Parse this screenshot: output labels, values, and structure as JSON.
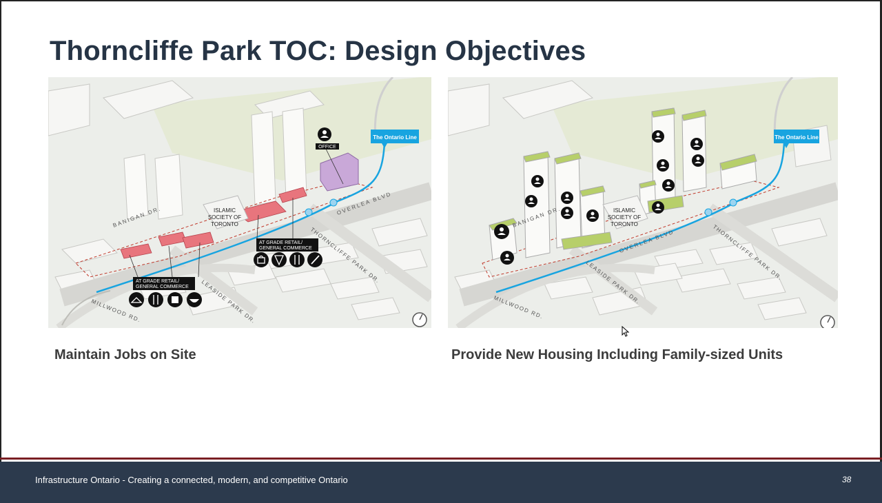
{
  "slide": {
    "title": "Thorncliffe Park TOC: Design Objectives",
    "left": {
      "caption": "Maintain Jobs on Site",
      "labels": {
        "ontario_line": "The Ontario Line",
        "office": "OFFICE",
        "islamic_1": "ISLAMIC",
        "islamic_2": "SOCIETY OF",
        "islamic_3": "TORONTO",
        "retail_a_1": "AT GRADE RETAIL/",
        "retail_a_2": "GENERAL COMMERCE",
        "retail_b_1": "AT GRADE RETAIL/",
        "retail_b_2": "GENERAL COMMERCE",
        "banigan": "BANIGAN DR.",
        "overlea": "OVERLEA BLVD",
        "thorncliffe": "THORNCLIFFE PARK DR.",
        "leaside": "LEASIDE PARK DR.",
        "millwood": "MILLWOOD RD."
      }
    },
    "right": {
      "caption": "Provide New Housing Including Family-sized Units",
      "labels": {
        "ontario_line": "The Ontario Line",
        "islamic_1": "ISLAMIC",
        "islamic_2": "SOCIETY OF",
        "islamic_3": "TORONTO",
        "banigan": "BANIGAN DR.",
        "overlea": "OVERLEA BLVD",
        "thorncliffe": "THORNCLIFFE PARK DR.",
        "leaside": "LEASIDE PARK DR.",
        "millwood": "MILLWOOD RD."
      }
    }
  },
  "footer": {
    "text": "Infrastructure Ontario - Creating a connected, modern, and competitive Ontario",
    "page_number": "38"
  },
  "colors": {
    "title": "#263445",
    "footer_bg": "#2c3a4d",
    "footer_rule": "#7a1f24",
    "retail_red": "#e8757d",
    "office_purple": "#c9a8d8",
    "housing_green": "#b7cf6a",
    "ontario_line_blue": "#18a4e0"
  },
  "icons": {
    "left": [
      "person-icon",
      "shopping-bag-icon",
      "pizza-icon",
      "restaurant-icon",
      "brush-icon",
      "hanger-icon",
      "utensils-icon",
      "shirt-icon",
      "food-bowl-icon",
      "north-arrow-icon"
    ],
    "right": [
      "person-icon",
      "family-icon",
      "north-arrow-icon"
    ]
  }
}
